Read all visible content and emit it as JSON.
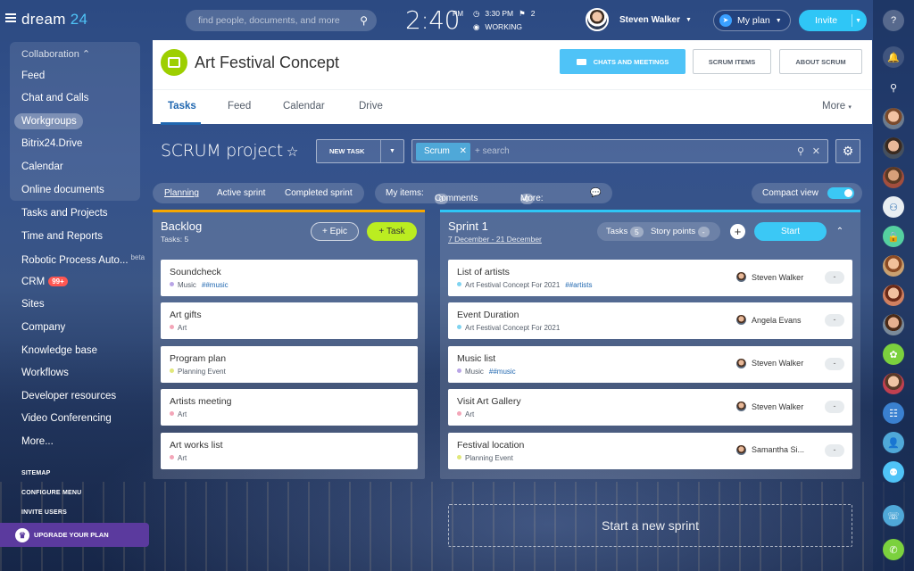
{
  "header": {
    "logo_main": "dream",
    "logo_num": "24",
    "search_placeholder": "find people, documents, and more",
    "clock": "2:40",
    "clock_ampm": "PM",
    "work_time": "3:30 PM",
    "flag_count": "2",
    "work_status": "WORKING",
    "user_name": "Steven Walker",
    "plan_label": "My plan",
    "invite_label": "Invite"
  },
  "sidebar": {
    "group_label": "Collaboration",
    "items": [
      {
        "label": "Feed"
      },
      {
        "label": "Chat and Calls"
      },
      {
        "label": "Workgroups"
      },
      {
        "label": "Bitrix24.Drive"
      },
      {
        "label": "Calendar"
      },
      {
        "label": "Online documents"
      },
      {
        "label": "Tasks and Projects"
      },
      {
        "label": "Time and Reports"
      },
      {
        "label": "Robotic Process Auto..."
      },
      {
        "label": "CRM"
      },
      {
        "label": "Sites"
      },
      {
        "label": "Company"
      },
      {
        "label": "Knowledge base"
      },
      {
        "label": "Workflows"
      },
      {
        "label": "Developer resources"
      },
      {
        "label": "Video Conferencing"
      },
      {
        "label": "More..."
      }
    ],
    "beta_label": "beta",
    "crm_badge": "99+",
    "sitemap": "SITEMAP",
    "configure": "CONFIGURE MENU",
    "invite_users": "INVITE USERS",
    "upgrade": "UPGRADE YOUR PLAN"
  },
  "project": {
    "title": "Art Festival Concept",
    "chats_btn": "CHATS AND MEETINGS",
    "scrum_items_btn": "SCRUM ITEMS",
    "about_btn": "ABOUT SCRUM",
    "tabs": [
      {
        "label": "Tasks"
      },
      {
        "label": "Feed"
      },
      {
        "label": "Calendar"
      },
      {
        "label": "Drive"
      }
    ],
    "more_label": "More"
  },
  "scrum": {
    "title": "SCRUM project",
    "new_task": "NEW TASK",
    "filter_chip": "Scrum",
    "filter_placeholder": "+ search",
    "view_tabs": {
      "planning": "Planning",
      "active": "Active sprint",
      "completed": "Completed sprint"
    },
    "my_items": "My items:",
    "comments_count": "0",
    "comments_label": "Comments",
    "more_label": "More:",
    "more_count": "0",
    "compact_view": "Compact view",
    "compact_on": true
  },
  "backlog": {
    "title": "Backlog",
    "subtitle": "Tasks: 5",
    "epic_btn": "Epic",
    "task_btn": "Task",
    "cards": [
      {
        "title": "Soundcheck",
        "epic": "Music",
        "tag": "##music",
        "dot": "#b9a5e6"
      },
      {
        "title": "Art gifts",
        "epic": "Art",
        "tag": "",
        "dot": "#f3a6b8"
      },
      {
        "title": "Program plan",
        "epic": "Planning Event",
        "tag": "",
        "dot": "#e1e87a"
      },
      {
        "title": "Artists meeting",
        "epic": "Art",
        "tag": "",
        "dot": "#f3a6b8"
      },
      {
        "title": "Art works list",
        "epic": "Art",
        "tag": "",
        "dot": "#f3a6b8"
      }
    ]
  },
  "sprint": {
    "title": "Sprint 1",
    "dates": "7 December - 21 December",
    "tasks_label": "Tasks",
    "tasks_count": "5",
    "sp_label": "Story points",
    "sp_value": "-",
    "start_btn": "Start",
    "cards": [
      {
        "title": "List of artists",
        "epic": "Art Festival Concept For 2021",
        "tag": "##artists",
        "dot": "#7fd3f0",
        "user": "Steven Walker",
        "sp": "-"
      },
      {
        "title": "Event Duration",
        "epic": "Art Festival Concept For 2021",
        "tag": "",
        "dot": "#7fd3f0",
        "user": "Angela Evans",
        "sp": "-"
      },
      {
        "title": "Music list",
        "epic": "Music",
        "tag": "##music",
        "dot": "#b9a5e6",
        "user": "Steven Walker",
        "sp": "-"
      },
      {
        "title": "Visit Art Gallery",
        "epic": "Art",
        "tag": "",
        "dot": "#f3a6b8",
        "user": "Steven Walker",
        "sp": "-"
      },
      {
        "title": "Festival location",
        "epic": "Planning Event",
        "tag": "",
        "dot": "#e1e87a",
        "user": "Samantha Si...",
        "sp": "-"
      }
    ],
    "new_sprint": "Start a new sprint"
  },
  "colors": {
    "accent": "#2fc6f6",
    "task_btn": "#bbed21",
    "backlog_bar": "#f7a700",
    "sprint_bar": "#2fc6f6"
  }
}
